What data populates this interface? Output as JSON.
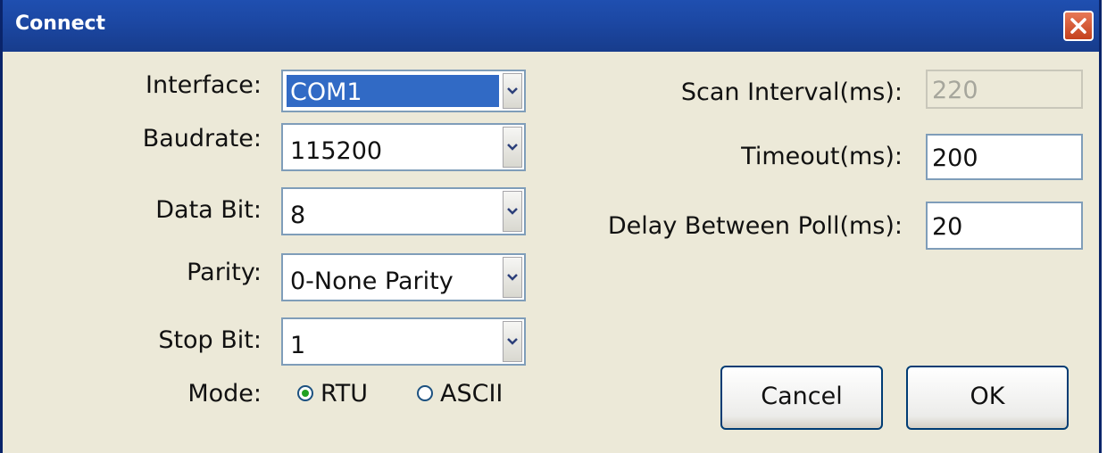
{
  "window": {
    "title": "Connect"
  },
  "form": {
    "interface": {
      "label": "Interface:",
      "value": "COM1"
    },
    "baudrate": {
      "label": "Baudrate:",
      "value": "115200"
    },
    "data_bit": {
      "label": "Data Bit:",
      "value": "8"
    },
    "parity": {
      "label": "Parity:",
      "value": "0-None Parity"
    },
    "stop_bit": {
      "label": "Stop Bit:",
      "value": "1"
    },
    "mode": {
      "label": "Mode:",
      "options": [
        "RTU",
        "ASCII"
      ],
      "selected": "RTU"
    },
    "scan_interval": {
      "label": "Scan Interval(ms):",
      "value": "220",
      "disabled": true
    },
    "timeout": {
      "label": "Timeout(ms):",
      "value": "200"
    },
    "delay": {
      "label": "Delay Between Poll(ms):",
      "value": "20"
    }
  },
  "buttons": {
    "cancel": "Cancel",
    "ok": "OK"
  },
  "icons": {
    "close": "close-icon",
    "dropdown": "chevron-down-icon"
  },
  "colors": {
    "titlebar": "#1c48a4",
    "client": "#ece9d8",
    "selection": "#316ac5",
    "close": "#d9582d"
  }
}
